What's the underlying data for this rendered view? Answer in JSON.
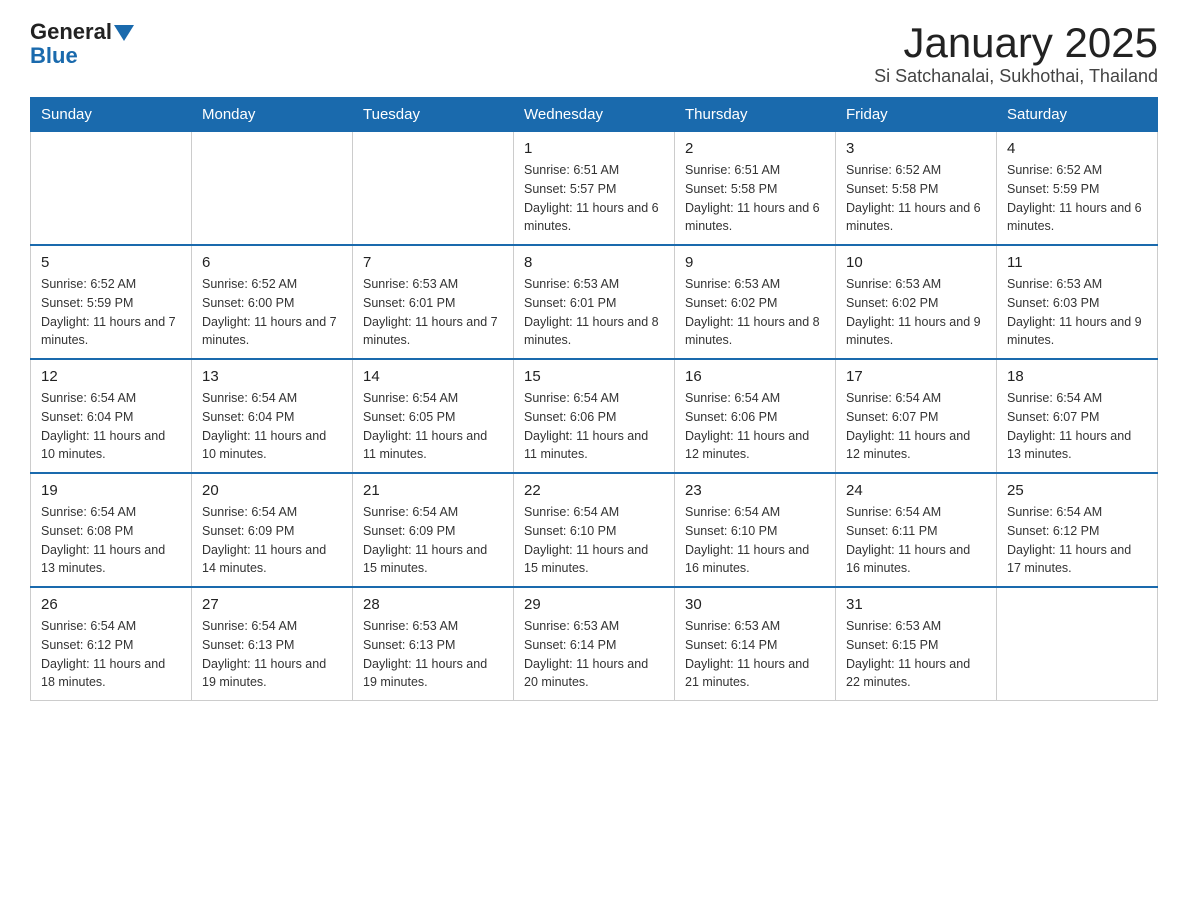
{
  "logo": {
    "text_general": "General",
    "text_blue": "Blue",
    "triangle_color": "#1a6aad"
  },
  "header": {
    "title": "January 2025",
    "subtitle": "Si Satchanalai, Sukhothai, Thailand"
  },
  "calendar": {
    "days_of_week": [
      "Sunday",
      "Monday",
      "Tuesday",
      "Wednesday",
      "Thursday",
      "Friday",
      "Saturday"
    ],
    "weeks": [
      [
        {
          "day": "",
          "info": ""
        },
        {
          "day": "",
          "info": ""
        },
        {
          "day": "",
          "info": ""
        },
        {
          "day": "1",
          "info": "Sunrise: 6:51 AM\nSunset: 5:57 PM\nDaylight: 11 hours and 6 minutes."
        },
        {
          "day": "2",
          "info": "Sunrise: 6:51 AM\nSunset: 5:58 PM\nDaylight: 11 hours and 6 minutes."
        },
        {
          "day": "3",
          "info": "Sunrise: 6:52 AM\nSunset: 5:58 PM\nDaylight: 11 hours and 6 minutes."
        },
        {
          "day": "4",
          "info": "Sunrise: 6:52 AM\nSunset: 5:59 PM\nDaylight: 11 hours and 6 minutes."
        }
      ],
      [
        {
          "day": "5",
          "info": "Sunrise: 6:52 AM\nSunset: 5:59 PM\nDaylight: 11 hours and 7 minutes."
        },
        {
          "day": "6",
          "info": "Sunrise: 6:52 AM\nSunset: 6:00 PM\nDaylight: 11 hours and 7 minutes."
        },
        {
          "day": "7",
          "info": "Sunrise: 6:53 AM\nSunset: 6:01 PM\nDaylight: 11 hours and 7 minutes."
        },
        {
          "day": "8",
          "info": "Sunrise: 6:53 AM\nSunset: 6:01 PM\nDaylight: 11 hours and 8 minutes."
        },
        {
          "day": "9",
          "info": "Sunrise: 6:53 AM\nSunset: 6:02 PM\nDaylight: 11 hours and 8 minutes."
        },
        {
          "day": "10",
          "info": "Sunrise: 6:53 AM\nSunset: 6:02 PM\nDaylight: 11 hours and 9 minutes."
        },
        {
          "day": "11",
          "info": "Sunrise: 6:53 AM\nSunset: 6:03 PM\nDaylight: 11 hours and 9 minutes."
        }
      ],
      [
        {
          "day": "12",
          "info": "Sunrise: 6:54 AM\nSunset: 6:04 PM\nDaylight: 11 hours and 10 minutes."
        },
        {
          "day": "13",
          "info": "Sunrise: 6:54 AM\nSunset: 6:04 PM\nDaylight: 11 hours and 10 minutes."
        },
        {
          "day": "14",
          "info": "Sunrise: 6:54 AM\nSunset: 6:05 PM\nDaylight: 11 hours and 11 minutes."
        },
        {
          "day": "15",
          "info": "Sunrise: 6:54 AM\nSunset: 6:06 PM\nDaylight: 11 hours and 11 minutes."
        },
        {
          "day": "16",
          "info": "Sunrise: 6:54 AM\nSunset: 6:06 PM\nDaylight: 11 hours and 12 minutes."
        },
        {
          "day": "17",
          "info": "Sunrise: 6:54 AM\nSunset: 6:07 PM\nDaylight: 11 hours and 12 minutes."
        },
        {
          "day": "18",
          "info": "Sunrise: 6:54 AM\nSunset: 6:07 PM\nDaylight: 11 hours and 13 minutes."
        }
      ],
      [
        {
          "day": "19",
          "info": "Sunrise: 6:54 AM\nSunset: 6:08 PM\nDaylight: 11 hours and 13 minutes."
        },
        {
          "day": "20",
          "info": "Sunrise: 6:54 AM\nSunset: 6:09 PM\nDaylight: 11 hours and 14 minutes."
        },
        {
          "day": "21",
          "info": "Sunrise: 6:54 AM\nSunset: 6:09 PM\nDaylight: 11 hours and 15 minutes."
        },
        {
          "day": "22",
          "info": "Sunrise: 6:54 AM\nSunset: 6:10 PM\nDaylight: 11 hours and 15 minutes."
        },
        {
          "day": "23",
          "info": "Sunrise: 6:54 AM\nSunset: 6:10 PM\nDaylight: 11 hours and 16 minutes."
        },
        {
          "day": "24",
          "info": "Sunrise: 6:54 AM\nSunset: 6:11 PM\nDaylight: 11 hours and 16 minutes."
        },
        {
          "day": "25",
          "info": "Sunrise: 6:54 AM\nSunset: 6:12 PM\nDaylight: 11 hours and 17 minutes."
        }
      ],
      [
        {
          "day": "26",
          "info": "Sunrise: 6:54 AM\nSunset: 6:12 PM\nDaylight: 11 hours and 18 minutes."
        },
        {
          "day": "27",
          "info": "Sunrise: 6:54 AM\nSunset: 6:13 PM\nDaylight: 11 hours and 19 minutes."
        },
        {
          "day": "28",
          "info": "Sunrise: 6:53 AM\nSunset: 6:13 PM\nDaylight: 11 hours and 19 minutes."
        },
        {
          "day": "29",
          "info": "Sunrise: 6:53 AM\nSunset: 6:14 PM\nDaylight: 11 hours and 20 minutes."
        },
        {
          "day": "30",
          "info": "Sunrise: 6:53 AM\nSunset: 6:14 PM\nDaylight: 11 hours and 21 minutes."
        },
        {
          "day": "31",
          "info": "Sunrise: 6:53 AM\nSunset: 6:15 PM\nDaylight: 11 hours and 22 minutes."
        },
        {
          "day": "",
          "info": ""
        }
      ]
    ]
  }
}
